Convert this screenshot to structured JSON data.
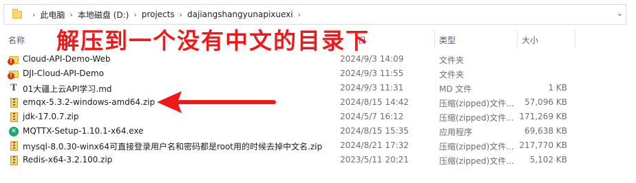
{
  "breadcrumb": {
    "items": [
      "此电脑",
      "本地磁盘 (D:)",
      "projects",
      "dajiangshangyunapixuexi"
    ],
    "separator": "›",
    "dropdown": "⌄"
  },
  "columns": {
    "name": "名称",
    "date": "日",
    "type": "类型",
    "size": "大小"
  },
  "annotation": "解压到一个没有中文的目录下",
  "files": [
    {
      "name": "Cloud-API-Demo-Web",
      "date": "2024/9/3 14:09",
      "type": "文件夹",
      "size": "",
      "icon": "folder-icon"
    },
    {
      "name": "DJI-Cloud-API-Demo",
      "date": "2024/9/3 11:55",
      "type": "文件夹",
      "size": "",
      "icon": "folder-icon"
    },
    {
      "name": "01大疆上云API学习.md",
      "date": "2024/9/3 11:31",
      "type": "MD 文件",
      "size": "1 KB",
      "icon": "text-file-icon"
    },
    {
      "name": "emqx-5.3.2-windows-amd64.zip",
      "date": "2024/8/15 14:42",
      "type": "压缩(zipped)文件...",
      "size": "57,096 KB",
      "icon": "zip-icon"
    },
    {
      "name": "jdk-17.0.7.zip",
      "date": "2024/5/7 16:12",
      "type": "压缩(zipped)文件...",
      "size": "171,269 KB",
      "icon": "zip-icon"
    },
    {
      "name": "MQTTX-Setup-1.10.1-x64.exe",
      "date": "2024/8/15 15:35",
      "type": "应用程序",
      "size": "69,638 KB",
      "icon": "app-icon"
    },
    {
      "name": "mysql-8.0.30-winx64可直接登录用户名和密码都是root用的时候去掉中文名.zip",
      "date": "2024/8/21 17:32",
      "type": "压缩(zipped)文件...",
      "size": "217,770 KB",
      "icon": "zip-icon"
    },
    {
      "name": "Redis-x64-3.2.100.zip",
      "date": "2023/5/11 20:21",
      "type": "压缩(zipped)文件...",
      "size": "5,102 KB",
      "icon": "zip-icon"
    }
  ],
  "colors": {
    "annotation": "#f01818",
    "header_text": "#4c607a",
    "folder": "#f8d775"
  }
}
